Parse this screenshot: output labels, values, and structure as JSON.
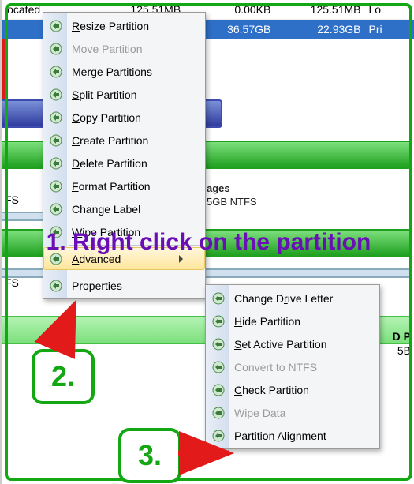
{
  "table": {
    "rows": [
      {
        "name": "located",
        "size": "125.51MB",
        "used": "0.00KB",
        "free": "125.51MB",
        "type": "Lo"
      },
      {
        "name": "",
        "size": "",
        "used": "36.57GB",
        "free": "22.93GB",
        "type": "Pri"
      }
    ]
  },
  "labels": {
    "fs1": "FS",
    "fs2": "FS",
    "partInfo1": "ages",
    "partInfo2": "5GB NTFS",
    "corner1": "D P",
    "corner2": "5B"
  },
  "menu1": {
    "items": [
      {
        "id": "resize",
        "label": "Resize Partition",
        "u": "R",
        "enabled": true,
        "sub": false,
        "interact": true
      },
      {
        "id": "move",
        "label": "Move Partition",
        "u": "",
        "enabled": false,
        "sub": false,
        "interact": false
      },
      {
        "id": "merge",
        "label": "Merge Partitions",
        "u": "M",
        "enabled": true,
        "sub": false,
        "interact": true
      },
      {
        "id": "split",
        "label": "Split Partition",
        "u": "S",
        "enabled": true,
        "sub": false,
        "interact": true
      },
      {
        "id": "copy",
        "label": "Copy Partition",
        "u": "C",
        "enabled": true,
        "sub": false,
        "interact": true
      },
      {
        "id": "create",
        "label": "Create Partition",
        "u": "C",
        "enabled": true,
        "sub": false,
        "interact": true
      },
      {
        "id": "delete",
        "label": "Delete Partition",
        "u": "D",
        "enabled": true,
        "sub": false,
        "interact": true
      },
      {
        "id": "format",
        "label": "Format Partition",
        "u": "F",
        "enabled": true,
        "sub": false,
        "interact": true
      },
      {
        "id": "label",
        "label": "Change Label",
        "u": "",
        "enabled": true,
        "sub": false,
        "interact": true
      },
      {
        "id": "wipe",
        "label": "Wipe Partition",
        "u": "W",
        "enabled": true,
        "sub": false,
        "interact": true
      },
      {
        "id": "advanced",
        "label": "Advanced",
        "u": "A",
        "enabled": true,
        "sub": true,
        "interact": true,
        "hover": true
      },
      {
        "id": "properties",
        "label": "Properties",
        "u": "P",
        "enabled": true,
        "sub": false,
        "interact": true
      }
    ]
  },
  "menu2": {
    "items": [
      {
        "id": "chletter",
        "label": "Change Drive Letter",
        "u": "r",
        "enabled": true,
        "interact": true
      },
      {
        "id": "hide",
        "label": "Hide Partition",
        "u": "H",
        "enabled": true,
        "interact": true
      },
      {
        "id": "active",
        "label": "Set Active Partition",
        "u": "S",
        "enabled": true,
        "interact": true
      },
      {
        "id": "convert",
        "label": "Convert to NTFS",
        "u": "",
        "enabled": false,
        "interact": false
      },
      {
        "id": "check",
        "label": "Check Partition",
        "u": "C",
        "enabled": true,
        "interact": true
      },
      {
        "id": "wipedata",
        "label": "Wipe Data",
        "u": "",
        "enabled": false,
        "interact": false
      },
      {
        "id": "align",
        "label": "Partition Alignment",
        "u": "P",
        "enabled": true,
        "interact": true
      }
    ]
  },
  "callouts": {
    "c1": "1. Right click on the partition",
    "c2": "2.",
    "c3": "3."
  },
  "icons": {
    "resize": "disk-resize-icon",
    "move": "disk-move-icon",
    "merge": "disk-merge-icon",
    "split": "disk-split-icon",
    "copy": "disk-copy-icon",
    "create": "disk-create-icon",
    "delete": "disk-delete-icon",
    "format": "disk-format-icon",
    "label": "label-icon",
    "wipe": "eraser-icon",
    "advanced": "",
    "properties": "gear-icon",
    "chletter": "drive-letter-icon",
    "hide": "disk-hide-icon",
    "active": "disk-active-icon",
    "convert": "convert-icon",
    "check": "check-shield-icon",
    "wipedata": "wipe-icon",
    "align": "align-icon"
  },
  "colors": {
    "accent": "#13a813",
    "danger": "#e21a1a",
    "annotation": "#6a0fb5"
  }
}
